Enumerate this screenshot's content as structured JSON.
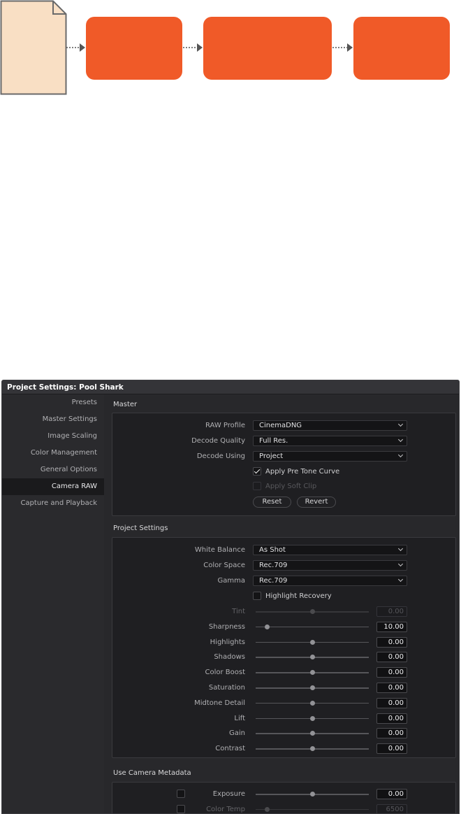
{
  "window": {
    "title": "Project Settings:  Pool Shark"
  },
  "sidebar": {
    "items": [
      {
        "label": "Presets",
        "active": false
      },
      {
        "label": "Master Settings",
        "active": false
      },
      {
        "label": "Image Scaling",
        "active": false
      },
      {
        "label": "Color Management",
        "active": false
      },
      {
        "label": "General Options",
        "active": false
      },
      {
        "label": "Camera RAW",
        "active": true
      },
      {
        "label": "Capture and Playback",
        "active": false
      }
    ]
  },
  "master": {
    "title": "Master",
    "raw_profile": {
      "label": "RAW Profile",
      "value": "CinemaDNG"
    },
    "decode_quality": {
      "label": "Decode Quality",
      "value": "Full Res."
    },
    "decode_using": {
      "label": "Decode Using",
      "value": "Project"
    },
    "apply_pre_tone_curve": {
      "label": "Apply Pre Tone Curve",
      "checked": true,
      "enabled": true
    },
    "apply_soft_clip": {
      "label": "Apply Soft Clip",
      "checked": false,
      "enabled": false
    },
    "reset_label": "Reset",
    "revert_label": "Revert"
  },
  "project_settings": {
    "title": "Project Settings",
    "white_balance": {
      "label": "White Balance",
      "value": "As Shot"
    },
    "color_space": {
      "label": "Color Space",
      "value": "Rec.709"
    },
    "gamma": {
      "label": "Gamma",
      "value": "Rec.709"
    },
    "highlight_recovery": {
      "label": "Highlight Recovery",
      "checked": false
    },
    "sliders": [
      {
        "label": "Tint",
        "value": "0.00",
        "level": 0.5,
        "enabled": false
      },
      {
        "label": "Sharpness",
        "value": "10.00",
        "level": 0.1,
        "enabled": true
      },
      {
        "label": "Highlights",
        "value": "0.00",
        "level": 0.5,
        "enabled": true
      },
      {
        "label": "Shadows",
        "value": "0.00",
        "level": 0.5,
        "enabled": true
      },
      {
        "label": "Color Boost",
        "value": "0.00",
        "level": 0.5,
        "enabled": true
      },
      {
        "label": "Saturation",
        "value": "0.00",
        "level": 0.5,
        "enabled": true
      },
      {
        "label": "Midtone Detail",
        "value": "0.00",
        "level": 0.5,
        "enabled": true
      },
      {
        "label": "Lift",
        "value": "0.00",
        "level": 0.5,
        "enabled": true
      },
      {
        "label": "Gain",
        "value": "0.00",
        "level": 0.5,
        "enabled": true
      },
      {
        "label": "Contrast",
        "value": "0.00",
        "level": 0.5,
        "enabled": true
      }
    ]
  },
  "camera_metadata": {
    "title": "Use Camera Metadata",
    "rows": [
      {
        "label": "Exposure",
        "value": "0.00",
        "level": 0.5,
        "enabled": true,
        "checked": false
      },
      {
        "label": "Color Temp",
        "value": "6500",
        "level": 0.1,
        "enabled": false,
        "checked": false
      }
    ]
  },
  "colors": {
    "accent_orange": "#f05a28",
    "document_fill": "#f9dfc4",
    "window_bg": "#28282b"
  }
}
